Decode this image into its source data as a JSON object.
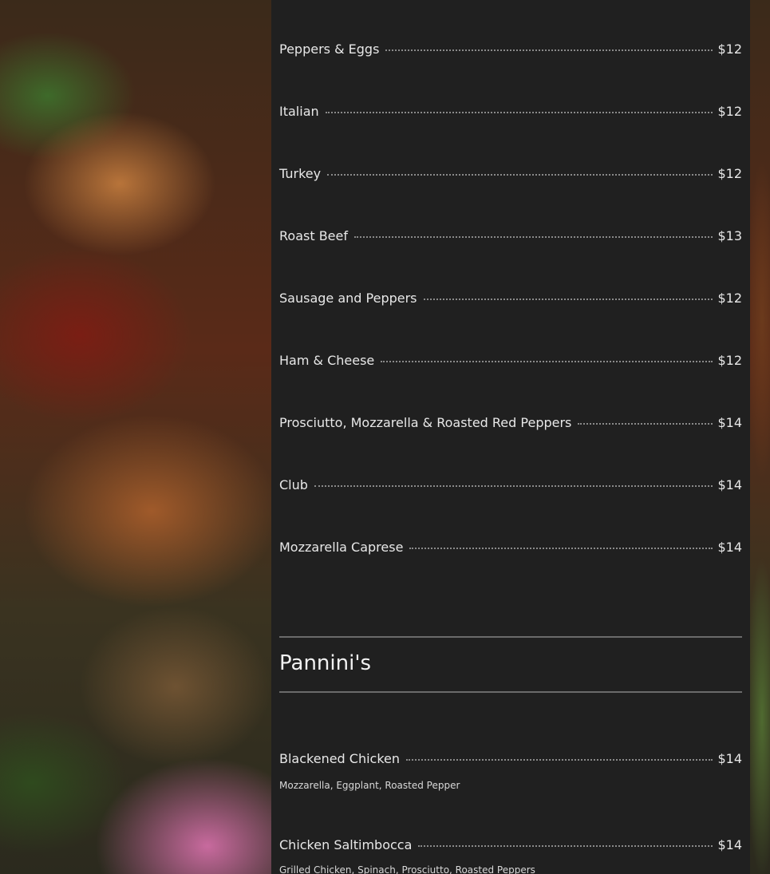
{
  "sandwiches": [
    {
      "name": "Peppers & Eggs",
      "price": "$12"
    },
    {
      "name": "Italian",
      "price": "$12"
    },
    {
      "name": "Turkey",
      "price": "$12"
    },
    {
      "name": "Roast Beef",
      "price": "$13"
    },
    {
      "name": "Sausage and Peppers",
      "price": "$12"
    },
    {
      "name": "Ham & Cheese",
      "price": "$12"
    },
    {
      "name": "Prosciutto, Mozzarella & Roasted Red Peppers",
      "price": "$14"
    },
    {
      "name": "Club",
      "price": "$14"
    },
    {
      "name": "Mozzarella Caprese",
      "price": "$14"
    }
  ],
  "paninis": {
    "title": "Pannini's",
    "items": [
      {
        "name": "Blackened Chicken",
        "price": "$14",
        "description": "Mozzarella, Eggplant, Roasted Pepper"
      },
      {
        "name": "Chicken Saltimbocca",
        "price": "$14",
        "description": "Grilled Chicken, Spinach, Prosciutto, Roasted Peppers"
      }
    ]
  }
}
